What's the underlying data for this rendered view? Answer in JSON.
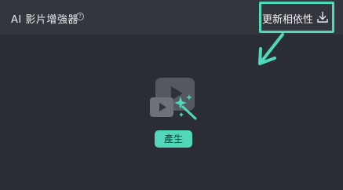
{
  "header": {
    "title": "AI 影片增強器",
    "help_icon": "question-circle-icon",
    "update_label": "更新相依性",
    "download_icon": "download-icon"
  },
  "main": {
    "illustration_icon": "video-magic-wand-icon",
    "generate_label": "產生"
  },
  "colors": {
    "accent": "#4fd9ba",
    "background": "#2a2d33",
    "header_bg": "#33363c"
  }
}
